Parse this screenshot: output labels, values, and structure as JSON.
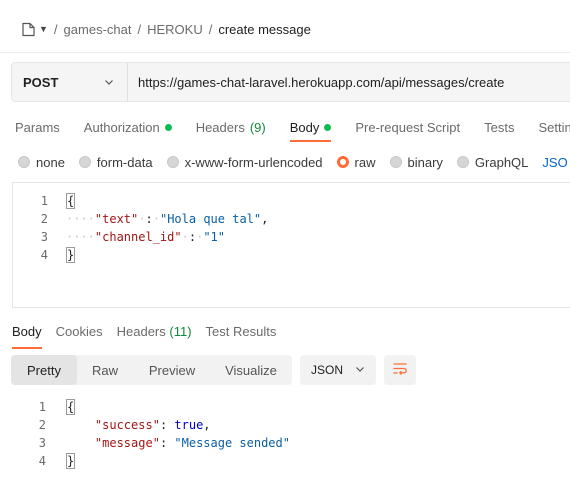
{
  "breadcrumb": {
    "items": [
      "games-chat",
      "HEROKU"
    ],
    "current": "create message",
    "separator": "/"
  },
  "request": {
    "method": "POST",
    "url": "https://games-chat-laravel.herokuapp.com/api/messages/create"
  },
  "request_tabs": [
    {
      "label": "Params"
    },
    {
      "label": "Authorization",
      "dot": true
    },
    {
      "label": "Headers",
      "count": "(9)"
    },
    {
      "label": "Body",
      "dot": true,
      "active": true
    },
    {
      "label": "Pre-request Script"
    },
    {
      "label": "Tests"
    },
    {
      "label": "Settin"
    }
  ],
  "body_types": [
    {
      "label": "none"
    },
    {
      "label": "form-data"
    },
    {
      "label": "x-www-form-urlencoded"
    },
    {
      "label": "raw",
      "selected": true
    },
    {
      "label": "binary"
    },
    {
      "label": "GraphQL"
    },
    {
      "label": "JSO"
    }
  ],
  "request_body": {
    "line_numbers": [
      "1",
      "2",
      "3",
      "4"
    ],
    "open": "{",
    "close": "}",
    "key1": "\"text\"",
    "val1": "\"Hola que tal\"",
    "key2": "\"channel_id\"",
    "val2": "\"1\""
  },
  "response_tabs": [
    {
      "label": "Body",
      "active": true
    },
    {
      "label": "Cookies"
    },
    {
      "label": "Headers",
      "count": "(11)"
    },
    {
      "label": "Test Results"
    }
  ],
  "view_modes": {
    "pretty": "Pretty",
    "raw": "Raw",
    "preview": "Preview",
    "visualize": "Visualize"
  },
  "format": "JSON",
  "response_body": {
    "line_numbers": [
      "1",
      "2",
      "3",
      "4"
    ],
    "open": "{",
    "close": "}",
    "key1": "\"success\"",
    "val1": "true",
    "key2": "\"message\"",
    "val2": "\"Message sended\""
  },
  "colors": {
    "accent": "#ff6c37",
    "dot_green": "#0cbb52",
    "link_blue": "#0265d2"
  }
}
